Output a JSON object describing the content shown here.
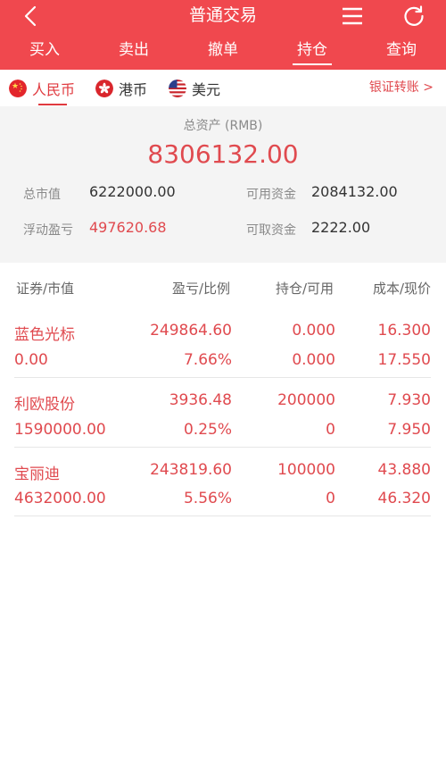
{
  "header": {
    "title": "普通交易"
  },
  "tabs": [
    {
      "label": "买入"
    },
    {
      "label": "卖出"
    },
    {
      "label": "撤单"
    },
    {
      "label": "持仓"
    },
    {
      "label": "查询"
    }
  ],
  "active_tab": "持仓",
  "currencies": [
    {
      "label": "人民币",
      "icon": "china-flag-icon"
    },
    {
      "label": "港币",
      "icon": "hong-kong-flag-icon"
    },
    {
      "label": "美元",
      "icon": "us-flag-icon"
    }
  ],
  "transfer_link": "银证转账 >",
  "summary": {
    "total_label": "总资产 (RMB)",
    "total_value": "8306132.00",
    "market_value_label": "总市值",
    "market_value": "6222000.00",
    "available_label": "可用资金",
    "available": "2084132.00",
    "floating_pl_label": "浮动盈亏",
    "floating_pl": "497620.68",
    "withdrawable_label": "可取资金",
    "withdrawable": "2222.00"
  },
  "table": {
    "columns": [
      "证券/市值",
      "盈亏/比例",
      "持仓/可用",
      "成本/现价"
    ],
    "rows": [
      {
        "name": "蓝色光标",
        "market_value": "0.00",
        "pl": "249864.60",
        "ratio": "7.66%",
        "position": "0.000",
        "available": "0.000",
        "cost": "16.300",
        "price": "17.550"
      },
      {
        "name": "利欧股份",
        "market_value": "1590000.00",
        "pl": "3936.48",
        "ratio": "0.25%",
        "position": "200000",
        "available": "0",
        "cost": "7.930",
        "price": "7.950"
      },
      {
        "name": "宝丽迪",
        "market_value": "4632000.00",
        "pl": "243819.60",
        "ratio": "5.56%",
        "position": "100000",
        "available": "0",
        "cost": "43.880",
        "price": "46.320"
      }
    ]
  },
  "colors": {
    "brand_red": "#f0484e",
    "value_red": "#e04a4f",
    "summary_bg": "#f4f4f4"
  },
  "icons": {
    "back": "back-arrow-icon",
    "menu": "menu-icon",
    "refresh": "refresh-icon"
  }
}
